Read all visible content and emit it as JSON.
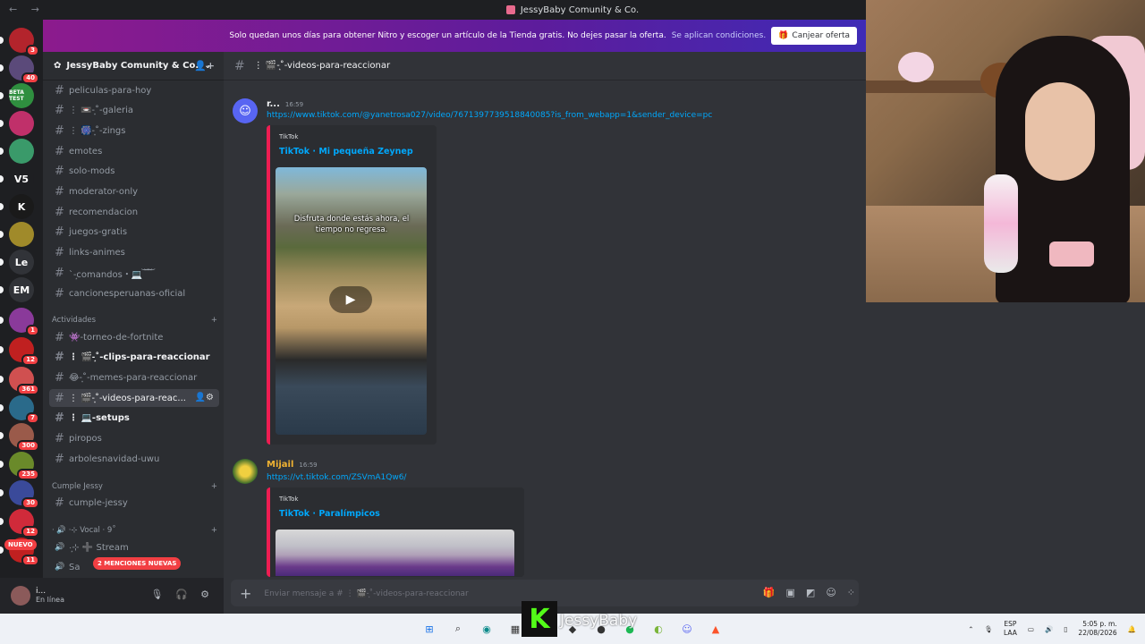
{
  "window": {
    "title": "JessyBaby Comunity & Co."
  },
  "promo": {
    "text": "Solo quedan unos días para obtener Nitro y escoger un artículo de la Tienda gratis. No dejes pasar la oferta.",
    "link": "Se aplican condiciones.",
    "button": "Canjear oferta"
  },
  "guilds": [
    {
      "label": "",
      "badge": "3",
      "color": "#b3242c"
    },
    {
      "label": "",
      "badge": "40",
      "color": "#5b4a7a"
    },
    {
      "label": "BETA TEST",
      "badge": "",
      "color": "#2f8f3f"
    },
    {
      "label": "",
      "badge": "",
      "color": "#c0306a"
    },
    {
      "label": "",
      "badge": "",
      "color": "#3a9a6a"
    },
    {
      "label": "V5",
      "badge": "",
      "color": "#1e1f22"
    },
    {
      "label": "K",
      "badge": "",
      "color": "#1a1a1a"
    },
    {
      "label": "",
      "badge": "",
      "color": "#a08a2a"
    },
    {
      "label": "Le",
      "badge": "",
      "color": "#313338"
    },
    {
      "label": "EM",
      "badge": "",
      "color": "#313338"
    },
    {
      "label": "",
      "badge": "1",
      "color": "#8a3a9a"
    },
    {
      "label": "",
      "badge": "12",
      "color": "#c02020"
    },
    {
      "label": "",
      "badge": "361",
      "color": "#d05050"
    },
    {
      "label": "",
      "badge": "7",
      "color": "#2a6a8a"
    },
    {
      "label": "",
      "badge": "300",
      "color": "#9a5a4a"
    },
    {
      "label": "",
      "badge": "235",
      "color": "#6a8a2a"
    },
    {
      "label": "",
      "badge": "30",
      "color": "#3a4a9a"
    },
    {
      "label": "",
      "badge": "12",
      "color": "#d02a3a"
    },
    {
      "label": "",
      "badge": "11",
      "color": "#c02020"
    }
  ],
  "nuevo": "NUEVO",
  "server": {
    "name": "JessyBaby Comunity & Co."
  },
  "channels": [
    {
      "name": "peliculas-para-hoy",
      "state": "normal"
    },
    {
      "name": "⋮ 📼-͙˚-galeria",
      "state": "normal"
    },
    {
      "name": "⋮ 🎆-͙˚-zings",
      "state": "normal"
    },
    {
      "name": "emotes",
      "state": "normal"
    },
    {
      "name": "solo-mods",
      "state": "normal"
    },
    {
      "name": "moderator-only",
      "state": "normal"
    },
    {
      "name": "recomendacion",
      "state": "normal"
    },
    {
      "name": "juegos-gratis",
      "state": "normal"
    },
    {
      "name": "links-animes",
      "state": "normal"
    },
    {
      "name": "ˋ-͙comandos・💻 ͝ ͝ ͝",
      "state": "normal"
    },
    {
      "name": "cancionesperuanas-oficial",
      "state": "normal"
    }
  ],
  "categories": {
    "actividades": "Actividades",
    "cumple": "Cumple Jessy",
    "vocal": "· 🔊 ·⊹ Vocal · 9˚"
  },
  "activity_channels": [
    {
      "name": "👾-torneo-de-fortnite",
      "state": "normal"
    },
    {
      "name": "⋮ 🎬-͙˚-clips-para-reaccionar",
      "state": "unread"
    },
    {
      "name": "😂-͙˚-memes-para-reaccionar",
      "state": "normal"
    },
    {
      "name": "⋮ 🎬-͙˚-videos-para-reac...",
      "state": "active"
    },
    {
      "name": "⋮ 💻-setups",
      "state": "unread"
    },
    {
      "name": "piropos",
      "state": "normal"
    },
    {
      "name": "arbolesnavidad-uwu",
      "state": "normal"
    }
  ],
  "cumple_channels": [
    {
      "name": "cumple-jessy"
    }
  ],
  "voice_channels": [
    {
      "name": "·͙⊹ ➕ Stream"
    },
    {
      "name": "Sa"
    }
  ],
  "mentions_pill": "2 MENCIONES NUEVAS",
  "user": {
    "name": "i...",
    "status": "En línea"
  },
  "header": {
    "channel": "⋮ 🎬-͙˚-videos-para-reaccionar"
  },
  "messages": [
    {
      "author": "r...",
      "time": "16:59",
      "link": "https://www.tiktok.com/@yanetrosa027/video/7671397739518840085?is_from_webapp=1&sender_device=pc",
      "embed_provider": "TikTok",
      "embed_title": "TikTok · Mi pequeña Zeynep",
      "video_caption": "Disfruta donde estás ahora, el tiempo no regresa."
    },
    {
      "author": "Mijail",
      "time": "16:59",
      "link": "https://vt.tiktok.com/ZSVmA1Qw6/",
      "embed_provider": "TikTok",
      "embed_title": "TikTok · Paralímpicos"
    }
  ],
  "composer": {
    "placeholder": "Enviar mensaje a # ⋮ 🎬-͙˚-videos-para-reaccionar"
  },
  "overlay": {
    "logo": "K",
    "name": "JessyBaby"
  },
  "tray": {
    "lang": "ESP",
    "layout": "LAA",
    "time": "5:05 p. m.",
    "date": "22/08/2026"
  },
  "colors": {
    "accent": "#5865f2",
    "link": "#00a8fc",
    "mention": "#f23f43",
    "tiktok": "#ee1d52",
    "author2": "#f0b232"
  }
}
